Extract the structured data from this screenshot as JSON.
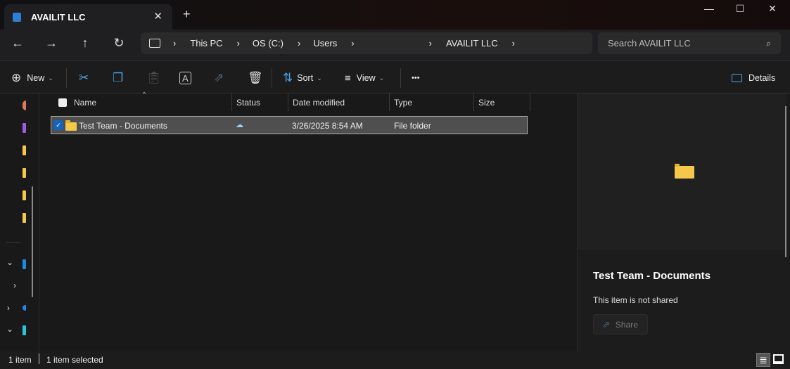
{
  "window": {
    "tab_title": "AVAILIT LLC",
    "new_tab": "+",
    "close_tab": "✕",
    "minimize": "—",
    "maximize": "☐",
    "close": "✕"
  },
  "nav": {
    "back": "←",
    "forward": "→",
    "up": "↑",
    "refresh": "↻"
  },
  "breadcrumb": [
    "This PC",
    "OS (C:)",
    "Users",
    "",
    "AVAILIT LLC"
  ],
  "search": {
    "placeholder": "Search AVAILIT LLC"
  },
  "toolbar": {
    "new": "New",
    "sort": "Sort",
    "view": "View",
    "more": "•••",
    "details": "Details"
  },
  "columns": [
    "Name",
    "Status",
    "Date modified",
    "Type",
    "Size"
  ],
  "files": [
    {
      "name": "Test Team - Documents",
      "status": "cloud",
      "date": "3/26/2025 8:54 AM",
      "type": "File folder",
      "size": ""
    }
  ],
  "details": {
    "title": "Test Team - Documents",
    "sharing": "This item is not shared",
    "share_button": "Share"
  },
  "status": {
    "count": "1 item",
    "selected": "1 item selected"
  },
  "colors": {
    "accent": "#4aa3e8",
    "selection": "#4f4f4f",
    "folder": "#f5c84c"
  }
}
